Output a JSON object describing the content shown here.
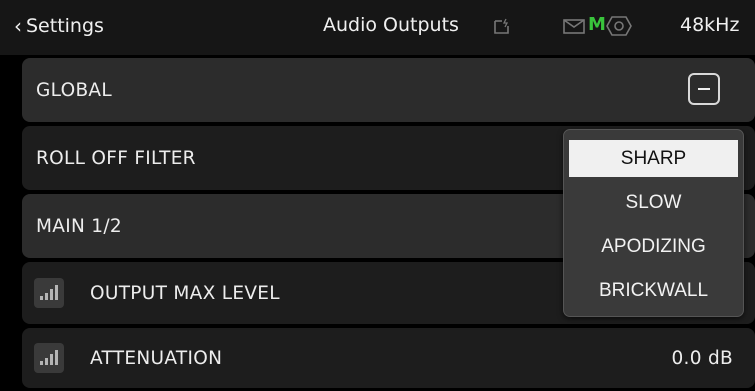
{
  "header": {
    "back_label": "Settings",
    "title": "Audio Outputs",
    "sample_rate": "48kHz",
    "status_m": "M",
    "icons": [
      "sd-card-icon",
      "mail-icon",
      "monitor-icon"
    ],
    "accent_green": "#39c43c"
  },
  "rows": {
    "global": {
      "label": "GLOBAL"
    },
    "roll_off": {
      "label": "ROLL OFF FILTER"
    },
    "main": {
      "label": "MAIN 1/2"
    },
    "output_max": {
      "label": "OUTPUT MAX LEVEL"
    },
    "attenuation": {
      "label": "ATTENUATION",
      "value": "0.0 dB"
    }
  },
  "dropdown": {
    "selected": "SHARP",
    "options": [
      "SHARP",
      "SLOW",
      "APODIZING",
      "BRICKWALL"
    ]
  }
}
